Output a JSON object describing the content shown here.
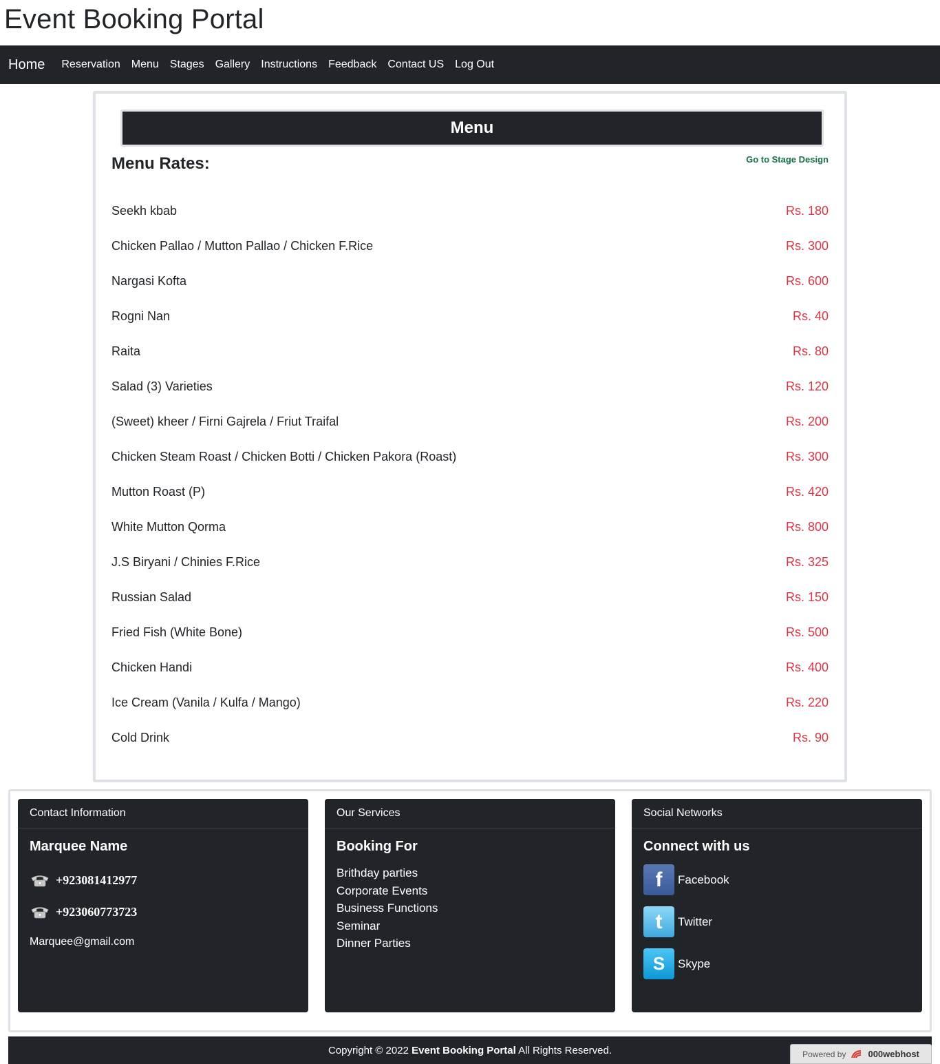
{
  "site_title": "Event Booking Portal",
  "nav": {
    "brand": "Home",
    "links": [
      "Reservation",
      "Menu",
      "Stages",
      "Gallery",
      "Instructions",
      "Feedback",
      "Contact US",
      "Log Out"
    ]
  },
  "menu": {
    "header": "Menu",
    "rates_title": "Menu Rates:",
    "stage_link": "Go to Stage Design",
    "items": [
      {
        "name": "Seekh kbab",
        "price": "Rs. 180"
      },
      {
        "name": "Chicken Pallao / Mutton Pallao / Chicken F.Rice",
        "price": "Rs. 300"
      },
      {
        "name": "Nargasi Kofta",
        "price": "Rs. 600"
      },
      {
        "name": "Rogni Nan",
        "price": "Rs. 40"
      },
      {
        "name": "Raita",
        "price": "Rs. 80"
      },
      {
        "name": "Salad (3) Varieties",
        "price": "Rs. 120"
      },
      {
        "name": "(Sweet) kheer / Firni Gajrela / Friut Traifal",
        "price": "Rs. 200"
      },
      {
        "name": "Chicken Steam Roast / Chicken Botti / Chicken Pakora (Roast)",
        "price": "Rs. 300"
      },
      {
        "name": "Mutton Roast (P)",
        "price": "Rs. 420"
      },
      {
        "name": "White Mutton Qorma",
        "price": "Rs. 800"
      },
      {
        "name": "J.S Biryani / Chinies F.Rice",
        "price": "Rs. 325"
      },
      {
        "name": "Russian Salad",
        "price": "Rs. 150"
      },
      {
        "name": "Fried Fish (White Bone)",
        "price": "Rs. 500"
      },
      {
        "name": "Chicken Handi",
        "price": "Rs. 400"
      },
      {
        "name": "Ice Cream (Vanila / Kulfa / Mango)",
        "price": "Rs. 220"
      },
      {
        "name": "Cold Drink",
        "price": "Rs. 90"
      }
    ]
  },
  "footer": {
    "contact": {
      "header": "Contact Information",
      "title": "Marquee Name",
      "phones": [
        "+923081412977",
        "+923060773723"
      ],
      "email": "Marquee@gmail.com"
    },
    "services": {
      "header": "Our Services",
      "title": "Booking For",
      "items": [
        "Brithday parties",
        "Corporate Events",
        "Business Functions",
        "Seminar",
        "Dinner Parties"
      ]
    },
    "social": {
      "header": "Social Networks",
      "title": "Connect with us",
      "items": [
        {
          "label": "Facebook",
          "icon": "facebook-icon",
          "color": "#3b5998"
        },
        {
          "label": "Twitter",
          "icon": "twitter-icon",
          "color": "#4ab3e6"
        },
        {
          "label": "Skype",
          "icon": "skype-icon",
          "color": "#1ca7e0"
        }
      ]
    }
  },
  "copyright": {
    "prefix": "Copyright © 2022 ",
    "brand": "Event Booking Portal",
    "suffix": " All Rights Reserved."
  },
  "powered": {
    "prefix": "Powered by",
    "host": "000webhost"
  }
}
